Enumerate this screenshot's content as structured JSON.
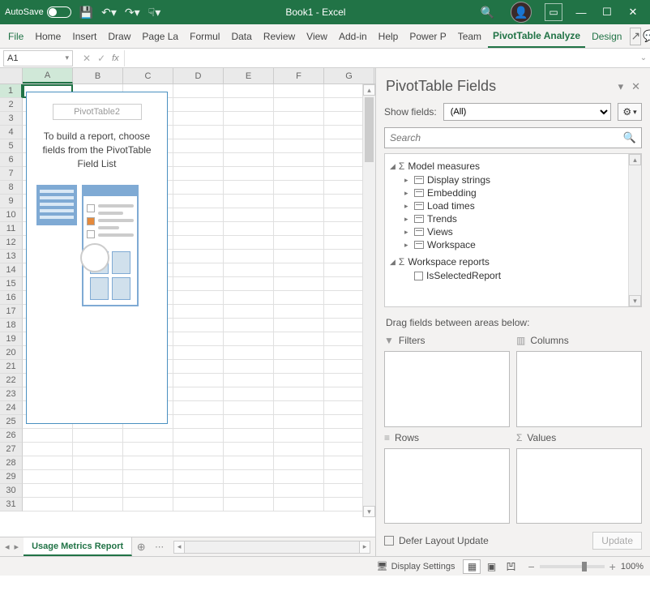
{
  "titlebar": {
    "autosave_label": "AutoSave",
    "autosave_state": "Off",
    "document_title": "Book1 - Excel"
  },
  "ribbon": {
    "tabs": [
      "File",
      "Home",
      "Insert",
      "Draw",
      "Page La",
      "Formul",
      "Data",
      "Review",
      "View",
      "Add-in",
      "Help",
      "Power P",
      "Team",
      "PivotTable Analyze",
      "Design"
    ]
  },
  "formula_bar": {
    "cell_ref": "A1",
    "fx_label": "fx",
    "formula": ""
  },
  "grid": {
    "columns": [
      "A",
      "B",
      "C",
      "D",
      "E",
      "F",
      "G"
    ],
    "row_count": 31,
    "selected_cell": "A1"
  },
  "pivot_placeholder": {
    "name": "PivotTable2",
    "text": "To build a report, choose fields from the PivotTable Field List"
  },
  "sheet_tabs": {
    "active": "Usage Metrics Report"
  },
  "pane": {
    "title": "PivotTable Fields",
    "show_fields_label": "Show fields:",
    "show_fields_value": "(All)",
    "search_placeholder": "Search",
    "groups": [
      {
        "name": "Model measures",
        "expanded": true,
        "items": [
          {
            "label": "Display strings",
            "type": "table"
          },
          {
            "label": "Embedding",
            "type": "table"
          },
          {
            "label": "Load times",
            "type": "table"
          },
          {
            "label": "Trends",
            "type": "table"
          },
          {
            "label": "Views",
            "type": "table"
          },
          {
            "label": "Workspace",
            "type": "table"
          }
        ]
      },
      {
        "name": "Workspace reports",
        "expanded": true,
        "items": [
          {
            "label": "IsSelectedReport",
            "type": "checkbox"
          }
        ]
      }
    ],
    "drag_text": "Drag fields between areas below:",
    "areas": {
      "filters": "Filters",
      "columns": "Columns",
      "rows": "Rows",
      "values": "Values"
    },
    "defer_label": "Defer Layout Update",
    "update_label": "Update"
  },
  "statusbar": {
    "display_settings": "Display Settings",
    "zoom_pct": "100%"
  }
}
